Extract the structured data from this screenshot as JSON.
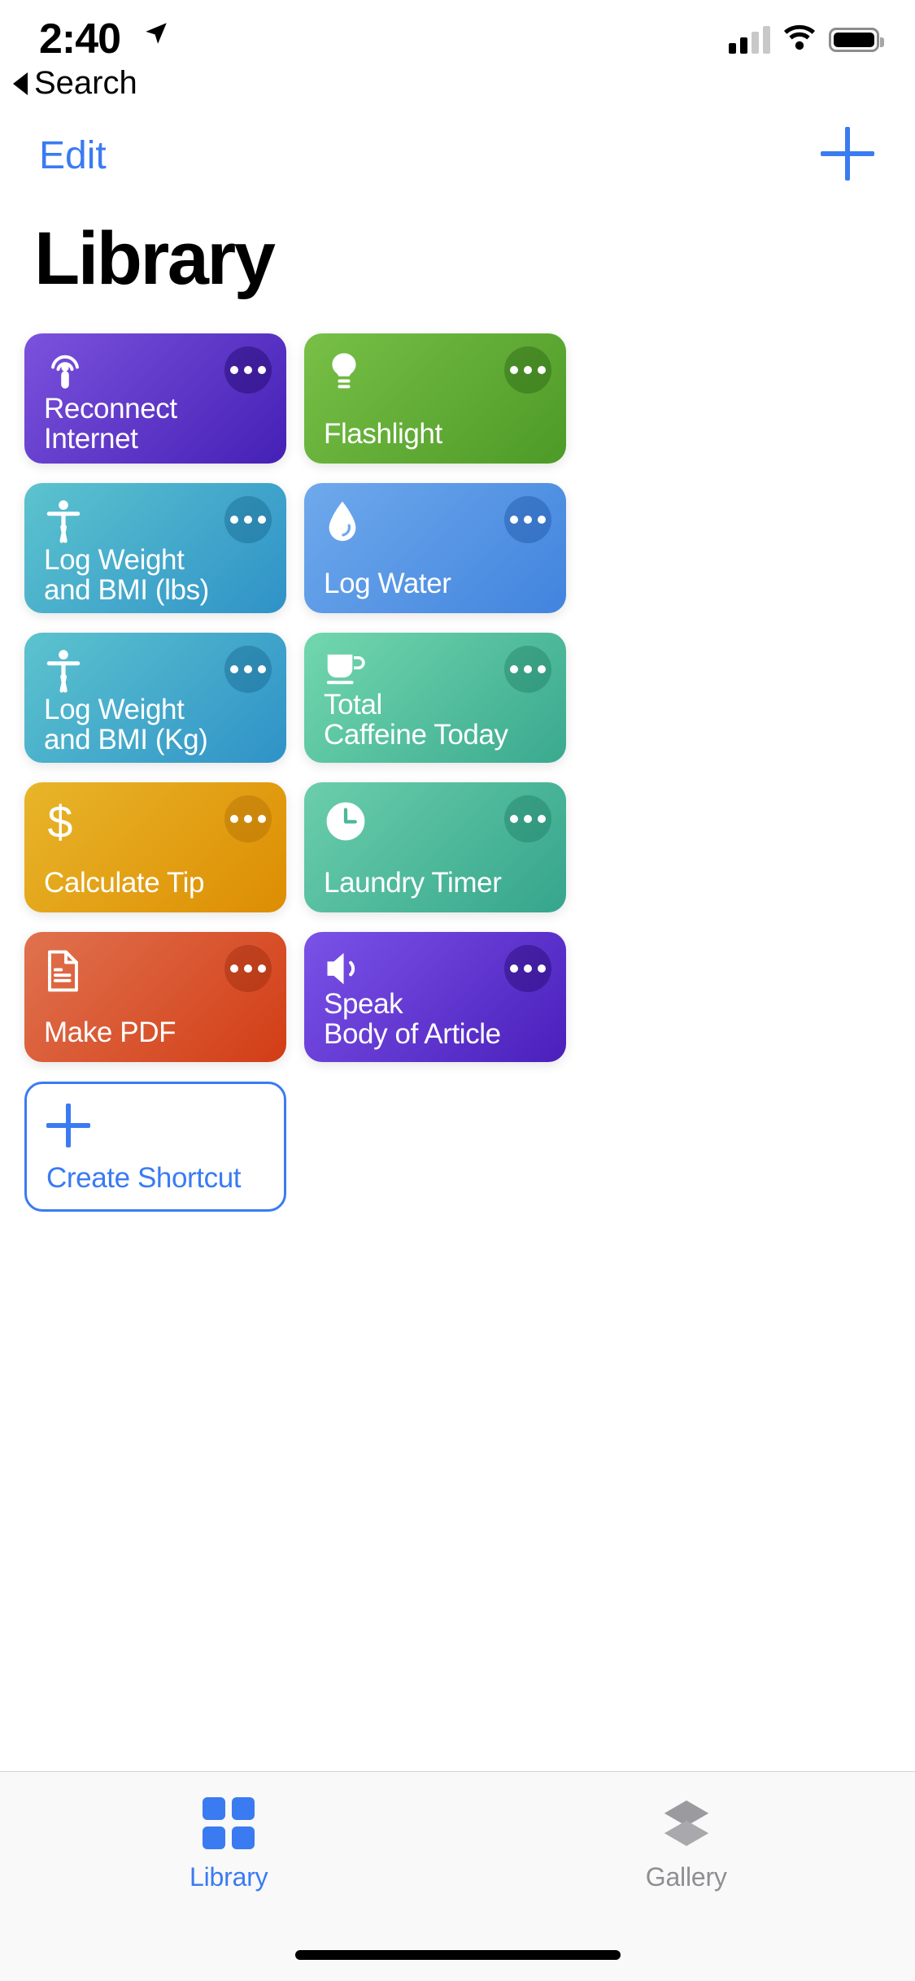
{
  "status_bar": {
    "time": "2:40",
    "location_icon": "location-arrow-icon",
    "signal_icon": "cellular-signal-icon",
    "wifi_icon": "wifi-icon",
    "battery_icon": "battery-icon"
  },
  "back_nav": {
    "label": "Search",
    "caret_icon": "back-caret-icon"
  },
  "navbar": {
    "edit_label": "Edit",
    "add_icon": "plus-icon",
    "accent_color": "#3a7bf2"
  },
  "header": {
    "title": "Library"
  },
  "shortcuts": [
    {
      "name": "Reconnect\nInternet",
      "icon": "broadcast-icon",
      "gradient_start": "#7b52dd",
      "gradient_end": "#4520b5",
      "menu_bg": "rgba(25,0,95,0.40)",
      "menu_icon": "ellipsis-icon"
    },
    {
      "name": "Flashlight",
      "icon": "lightbulb-icon",
      "gradient_start": "#78c047",
      "gradient_end": "#4d9a27",
      "menu_bg": "rgba(20,70,5,0.30)",
      "menu_icon": "ellipsis-icon"
    },
    {
      "name": "Log Weight\nand BMI (lbs)",
      "icon": "person-accessibility-icon",
      "gradient_start": "#5cc3ce",
      "gradient_end": "#2f92c8",
      "menu_bg": "rgba(0,70,110,0.28)",
      "menu_icon": "ellipsis-icon"
    },
    {
      "name": "Log Water",
      "icon": "water-drop-icon",
      "gradient_start": "#6fa9ec",
      "gradient_end": "#4184de",
      "menu_bg": "rgba(0,50,130,0.28)",
      "menu_icon": "ellipsis-icon"
    },
    {
      "name": "Log Weight\nand BMI (Kg)",
      "icon": "person-accessibility-icon",
      "gradient_start": "#5cc3ce",
      "gradient_end": "#2f92c8",
      "menu_bg": "rgba(0,70,110,0.28)",
      "menu_icon": "ellipsis-icon"
    },
    {
      "name": "Total\nCaffeine Today",
      "icon": "coffee-cup-icon",
      "gradient_start": "#72d7ae",
      "gradient_end": "#3aa98f",
      "menu_bg": "rgba(0,85,65,0.25)",
      "menu_icon": "ellipsis-icon"
    },
    {
      "name": "Calculate Tip",
      "icon": "dollar-sign-icon",
      "gradient_start": "#e8b52a",
      "gradient_end": "#dd8d02",
      "menu_bg": "rgba(150,85,0,0.28)",
      "menu_icon": "ellipsis-icon"
    },
    {
      "name": "Laundry Timer",
      "icon": "clock-icon",
      "gradient_start": "#6bceab",
      "gradient_end": "#35a58c",
      "menu_bg": "rgba(0,85,65,0.25)",
      "menu_icon": "ellipsis-icon"
    },
    {
      "name": "Make PDF",
      "icon": "document-icon",
      "gradient_start": "#e0724f",
      "gradient_end": "#d23d15",
      "menu_bg": "rgba(130,25,0,0.30)",
      "menu_icon": "ellipsis-icon"
    },
    {
      "name": "Speak\nBody of Article",
      "icon": "speaker-volume-icon",
      "gradient_start": "#7b52e8",
      "gradient_end": "#4a1fbb",
      "menu_bg": "rgba(25,0,95,0.38)",
      "menu_icon": "ellipsis-icon"
    }
  ],
  "create_shortcut": {
    "label": "Create Shortcut",
    "icon": "plus-icon",
    "border_color": "#3a7bf2"
  },
  "tabbar": {
    "tabs": [
      {
        "label": "Library",
        "icon": "grid-squares-icon",
        "active": true,
        "color": "#3a7bf2"
      },
      {
        "label": "Gallery",
        "icon": "layers-stack-icon",
        "active": false,
        "color": "#8e8e93"
      }
    ]
  }
}
